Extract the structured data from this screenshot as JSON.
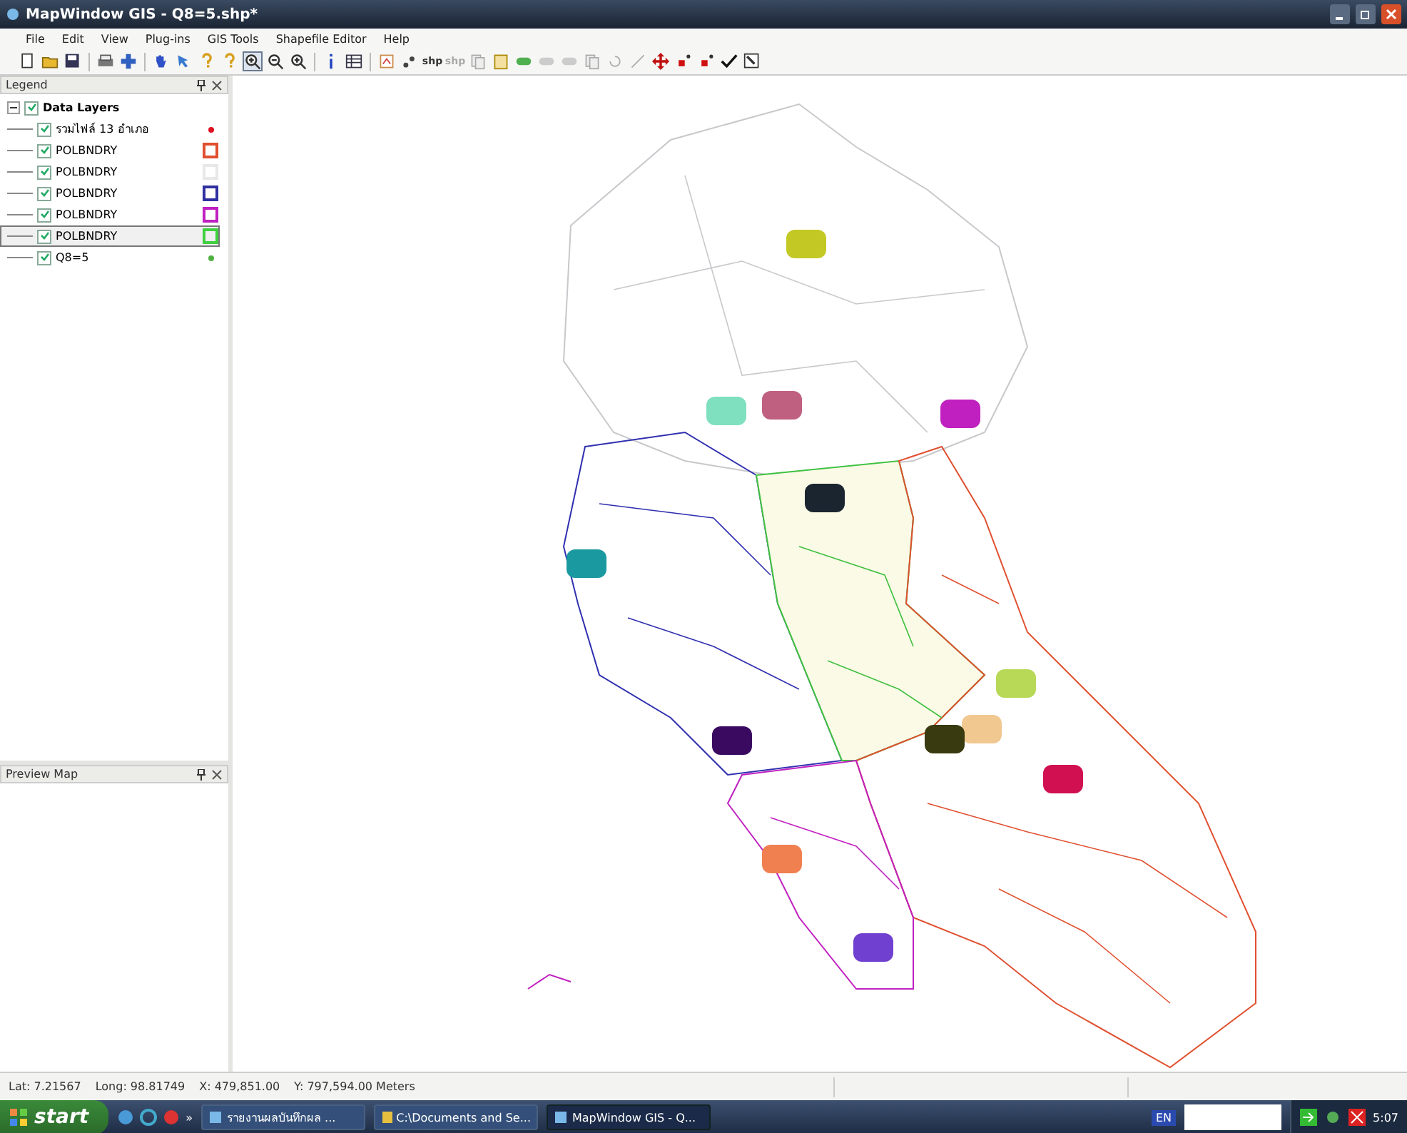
{
  "window": {
    "title": "MapWindow GIS  - Q8=5.shp*"
  },
  "menu": [
    "File",
    "Edit",
    "View",
    "Plug-ins",
    "GIS Tools",
    "Shapefile Editor",
    "Help"
  ],
  "toolbar": {
    "zoom_in": {
      "selected": true
    },
    "labels": [
      "shp",
      "shp"
    ]
  },
  "legend": {
    "title": "Legend",
    "group": {
      "label": "Data Layers",
      "checked": true,
      "expanded": true,
      "layers": [
        {
          "label": "รวมไฟล์ 13 อำเภอ",
          "kind": "point",
          "color": "#e01020",
          "checked": true,
          "selected": false
        },
        {
          "label": "POLBNDRY",
          "kind": "polygon",
          "color": "#e05030",
          "checked": true,
          "selected": false
        },
        {
          "label": "POLBNDRY",
          "kind": "polygon",
          "color": "#e8e8e8",
          "checked": true,
          "selected": false
        },
        {
          "label": "POLBNDRY",
          "kind": "polygon",
          "color": "#3030a0",
          "checked": true,
          "selected": false
        },
        {
          "label": "POLBNDRY",
          "kind": "polygon",
          "color": "#c020c0",
          "checked": true,
          "selected": false
        },
        {
          "label": "POLBNDRY",
          "kind": "polygon",
          "color": "#40d040",
          "checked": true,
          "selected": true
        },
        {
          "label": "Q8=5",
          "kind": "point",
          "color": "#50b040",
          "checked": true,
          "selected": false
        }
      ]
    }
  },
  "preview": {
    "title": "Preview Map"
  },
  "status_bar": [
    "Lat: 7.21567",
    "Long: 98.81749",
    "X: 479,851.00",
    "Y: 797,594.00 Meters"
  ],
  "taskbar": {
    "start": "start",
    "more": "»",
    "tasks": [
      {
        "label": "รายงานผลบันทึกผล ...",
        "selected": false
      },
      {
        "label": "C:\\Documents and Se...",
        "selected": false
      },
      {
        "label": "MapWindow GIS - Q...",
        "selected": true
      }
    ],
    "language": "EN",
    "time": "5:07"
  }
}
